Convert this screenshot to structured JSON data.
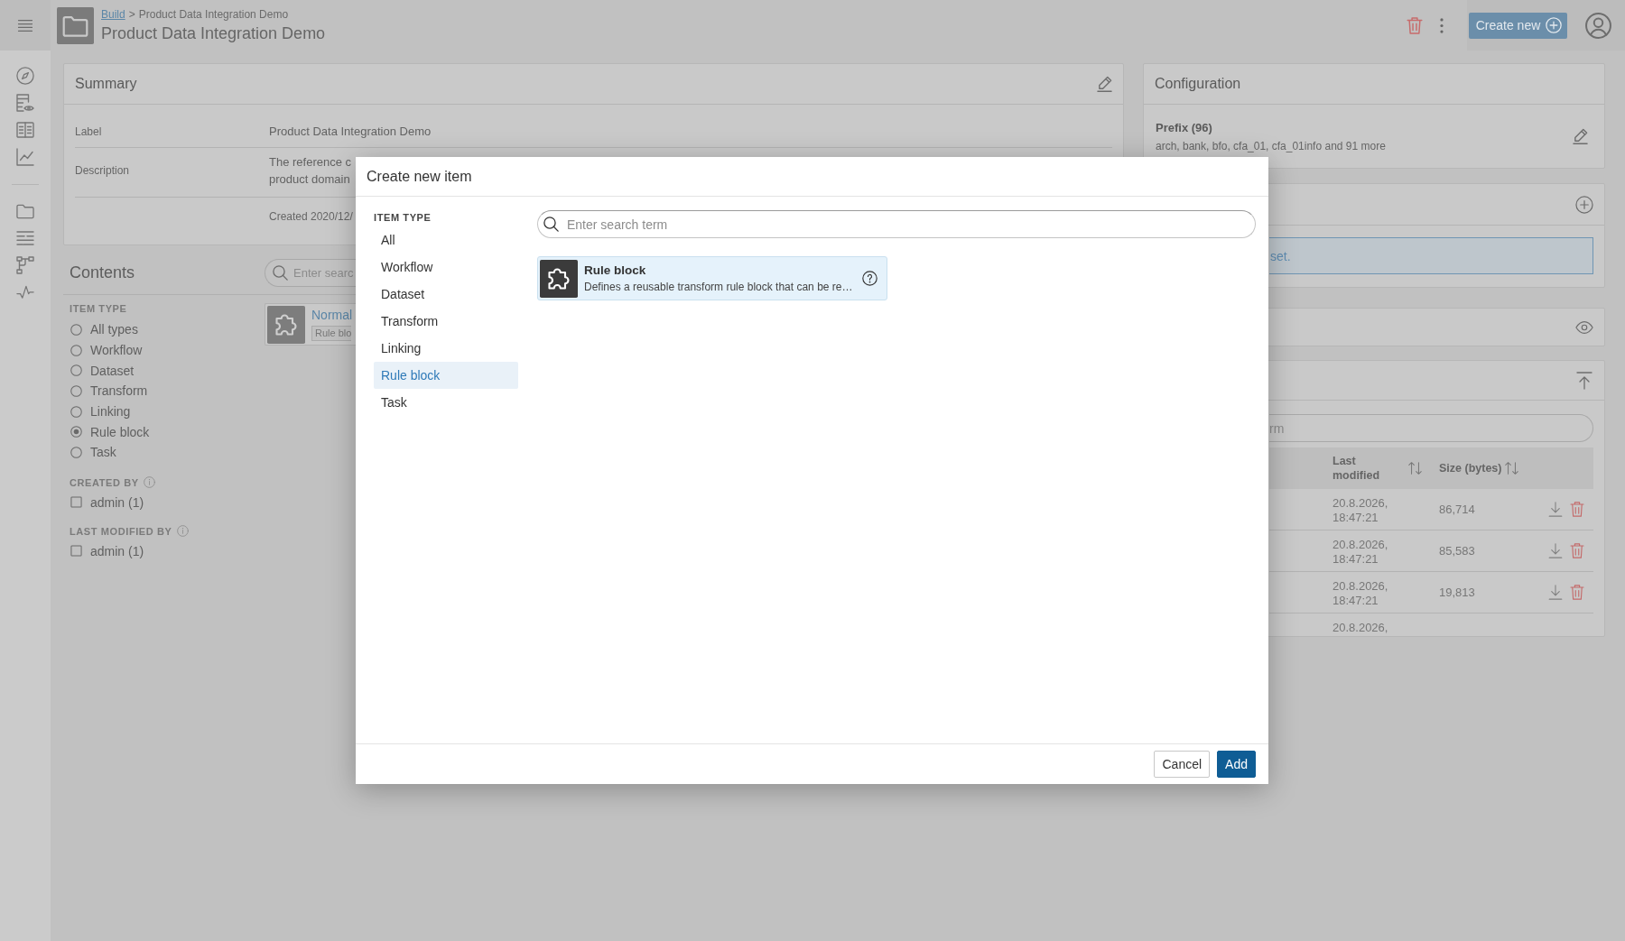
{
  "header": {
    "breadcrumb": {
      "parent": "Build",
      "separator": ">",
      "current": "Product Data Integration Demo"
    },
    "title": "Product Data Integration Demo",
    "create_button": "Create new"
  },
  "summary": {
    "title": "Summary",
    "rows": [
      {
        "label": "Label",
        "lines": [
          "Product Data Integration Demo"
        ]
      },
      {
        "label": "Description",
        "lines": [
          "The reference c",
          "product domain"
        ]
      }
    ],
    "created": "Created 2020/12/"
  },
  "contents": {
    "title": "Contents",
    "search": {
      "placeholder": "Enter searc"
    },
    "filters": [
      {
        "title": "ITEM TYPE",
        "kind": "radio",
        "info": false,
        "options": [
          {
            "label": "All types",
            "selected": false
          },
          {
            "label": "Workflow",
            "selected": false
          },
          {
            "label": "Dataset",
            "selected": false
          },
          {
            "label": "Transform",
            "selected": false
          },
          {
            "label": "Linking",
            "selected": false
          },
          {
            "label": "Rule block",
            "selected": true
          },
          {
            "label": "Task",
            "selected": false
          }
        ]
      },
      {
        "title": "CREATED BY",
        "kind": "checkbox",
        "info": true,
        "options": [
          {
            "label": "admin (1)",
            "checked": false
          }
        ]
      },
      {
        "title": "LAST MODIFIED BY",
        "kind": "checkbox",
        "info": true,
        "options": [
          {
            "label": "admin (1)",
            "checked": false
          }
        ]
      }
    ],
    "items": [
      {
        "name": "Normal",
        "tag": "Rule blo"
      }
    ]
  },
  "configuration": {
    "title": "Configuration",
    "prefix": {
      "title": "Prefix (96)",
      "values": "arch, bank, bfo, cfa_01, cfa_01info and 91 more"
    }
  },
  "side_panels": {
    "panel_2": {
      "message": "set."
    },
    "panel_4": {
      "search": {
        "placeholder": "rm"
      },
      "columns": [
        "Last modified",
        "Size (bytes)"
      ],
      "rows": [
        {
          "last_modified": "20.8.2026, 18:47:21",
          "size": "86,714"
        },
        {
          "last_modified": "20.8.2026, 18:47:21",
          "size": "85,583"
        },
        {
          "last_modified": "20.8.2026, 18:47:21",
          "size": "19,813"
        },
        {
          "last_modified": "20.8.2026,"
        }
      ]
    }
  },
  "modal": {
    "title": "Create new item",
    "item_type": {
      "title": "ITEM TYPE",
      "options": [
        {
          "label": "All",
          "selected": false
        },
        {
          "label": "Workflow",
          "selected": false
        },
        {
          "label": "Dataset",
          "selected": false
        },
        {
          "label": "Transform",
          "selected": false
        },
        {
          "label": "Linking",
          "selected": false
        },
        {
          "label": "Rule block",
          "selected": true
        },
        {
          "label": "Task",
          "selected": false
        }
      ]
    },
    "search": {
      "placeholder": "Enter search term"
    },
    "results": [
      {
        "title": "Rule block",
        "description": "Defines a reusable transform rule block that can be re…",
        "selected": true
      }
    ],
    "buttons": [
      {
        "label": "Cancel",
        "kind": "secondary"
      },
      {
        "label": "Add",
        "kind": "primary"
      }
    ]
  }
}
